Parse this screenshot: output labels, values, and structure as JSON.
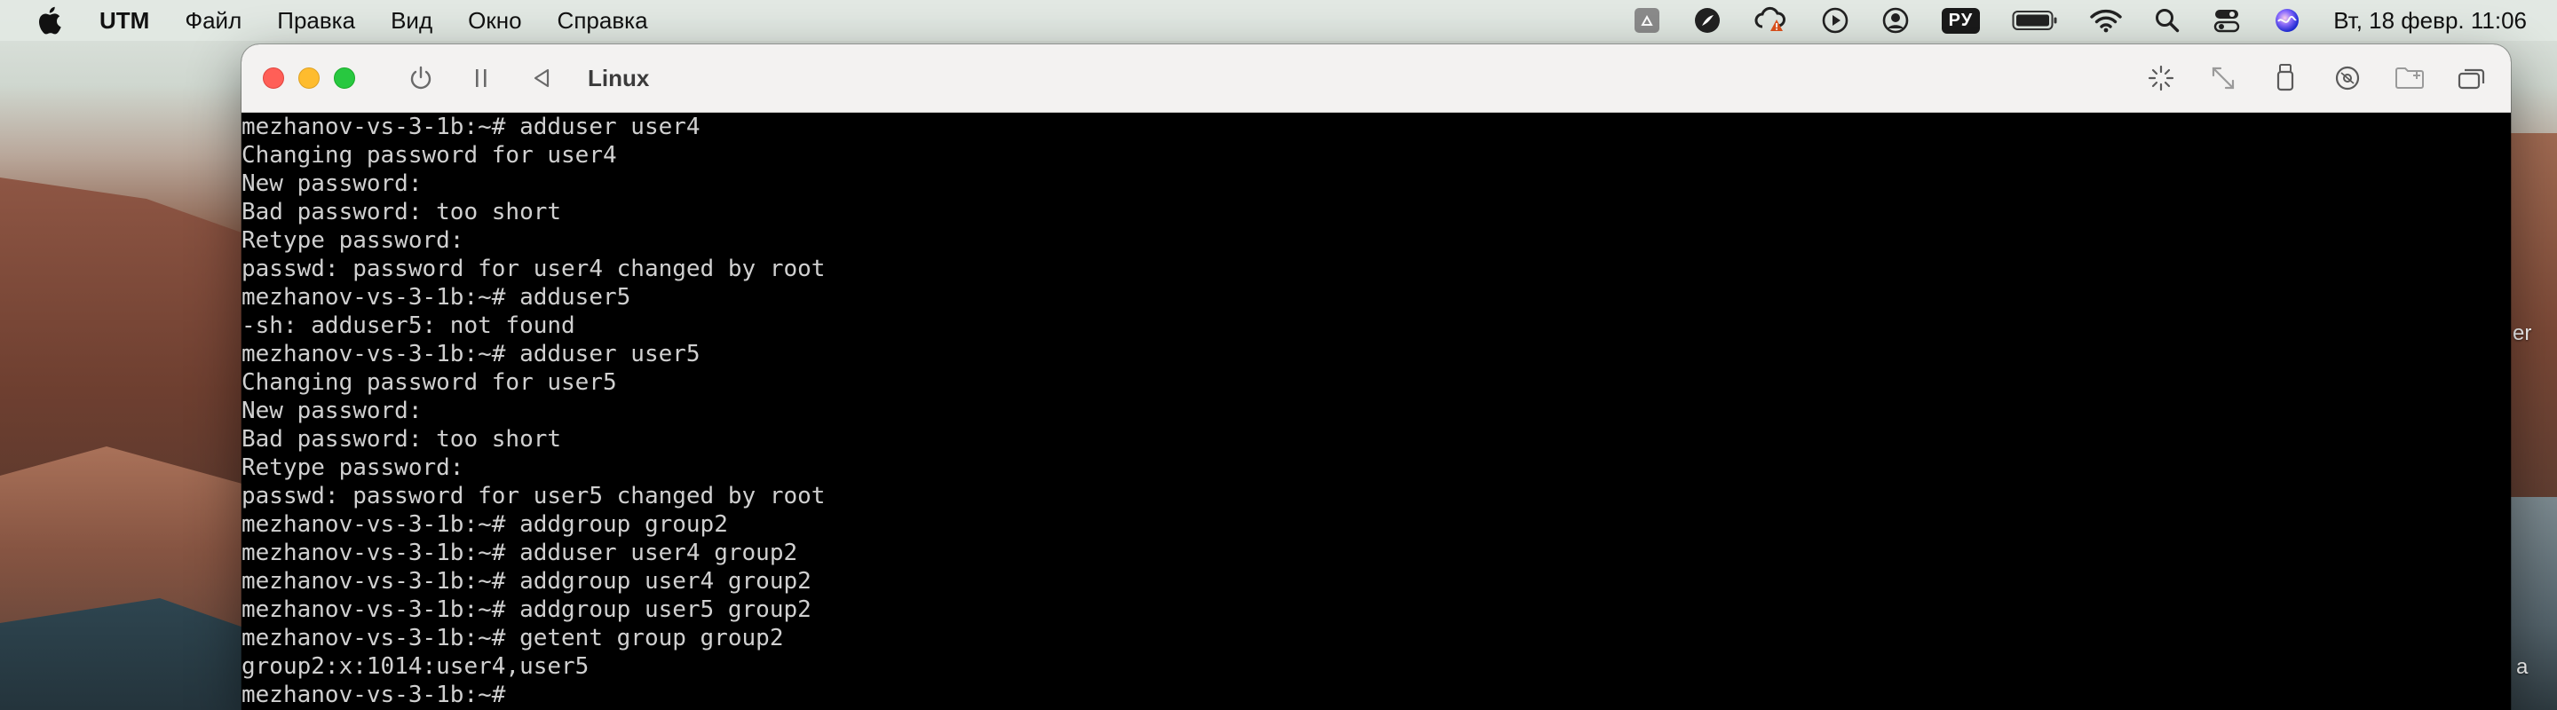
{
  "menubar": {
    "app_name": "UTM",
    "items": [
      "Файл",
      "Правка",
      "Вид",
      "Окно",
      "Справка"
    ],
    "input_source": "РУ",
    "clock": "Вт, 18 февр.  11:06"
  },
  "window": {
    "title": "Linux",
    "terminal_lines": [
      "mezhanov-vs-3-1b:~# adduser user4",
      "Changing password for user4",
      "New password:",
      "Bad password: too short",
      "Retype password:",
      "passwd: password for user4 changed by root",
      "mezhanov-vs-3-1b:~# adduser5",
      "-sh: adduser5: not found",
      "mezhanov-vs-3-1b:~# adduser user5",
      "Changing password for user5",
      "New password:",
      "Bad password: too short",
      "Retype password:",
      "passwd: password for user5 changed by root",
      "mezhanov-vs-3-1b:~# addgroup group2",
      "mezhanov-vs-3-1b:~# adduser user4 group2",
      "mezhanov-vs-3-1b:~# addgroup user4 group2",
      "mezhanov-vs-3-1b:~# addgroup user5 group2",
      "mezhanov-vs-3-1b:~# getent group group2",
      "group2:x:1014:user4,user5",
      "mezhanov-vs-3-1b:~#"
    ]
  },
  "desktop": {
    "label_1": "er",
    "label_2": "a"
  },
  "colors": {
    "close": "#ff5f57",
    "minimize": "#febc2e",
    "zoom": "#28c840",
    "terminal_bg": "#000000",
    "terminal_fg": "#d0d0d0"
  },
  "icons": {
    "menubar_tray": [
      "google-drive-icon",
      "feather-icon",
      "creative-cloud-warning-icon",
      "play-circle-icon",
      "user-circle-icon",
      "input-source-icon",
      "battery-icon",
      "wifi-icon",
      "spotlight-search-icon",
      "control-center-icon",
      "siri-icon"
    ],
    "toolbar": [
      "power-icon",
      "pause-icon",
      "back-icon",
      "usb-capture-icon",
      "resize-icon",
      "usb-drive-icon",
      "drive-image-icon",
      "shared-folder-icon",
      "windows-icon"
    ]
  }
}
